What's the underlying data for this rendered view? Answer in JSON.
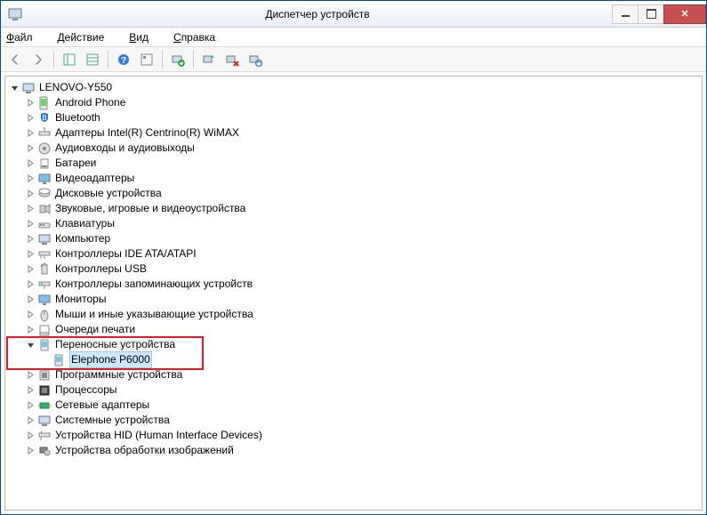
{
  "title": "Диспетчер устройств",
  "menus": {
    "file": "Файл",
    "action": "Действие",
    "view": "Вид",
    "help": "Справка"
  },
  "root": "LENOVO-Y550",
  "categories": [
    "Android Phone",
    "Bluetooth",
    "Адаптеры Intel(R) Centrino(R) WiMAX",
    "Аудиовходы и аудиовыходы",
    "Батареи",
    "Видеоадаптеры",
    "Дисковые устройства",
    "Звуковые, игровые и видеоустройства",
    "Клавиатуры",
    "Компьютер",
    "Контроллеры IDE ATA/ATAPI",
    "Контроллеры USB",
    "Контроллеры запоминающих устройств",
    "Мониторы",
    "Мыши и иные указывающие устройства",
    "Очереди печати",
    "Переносные устройства",
    "Программные устройства",
    "Процессоры",
    "Сетевые адаптеры",
    "Системные устройства",
    "Устройства HID (Human Interface Devices)",
    "Устройства обработки изображений"
  ],
  "expandedIndex": 16,
  "expandedChild": "Elephone P6000"
}
